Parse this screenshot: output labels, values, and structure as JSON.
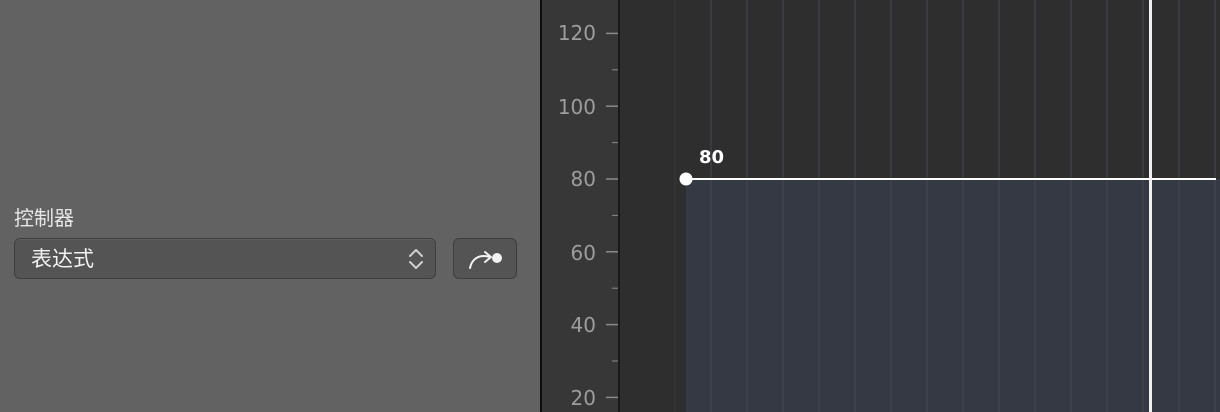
{
  "controller": {
    "label": "控制器",
    "selected_value": "表达式",
    "popup_icon": "chevron-up-down-icon",
    "action_icon": "arrow-to-point-icon"
  },
  "ruler": {
    "ticks": [
      "120",
      "100",
      "80",
      "60",
      "40",
      "20"
    ]
  },
  "automation": {
    "point_value": "80",
    "line_value": 80
  },
  "colors": {
    "panel_background": "#626262",
    "graph_background": "#2e2e2e",
    "automation_fill": "#353944",
    "automation_line": "#ffffff",
    "ruler_text": "#9d9d9d"
  }
}
